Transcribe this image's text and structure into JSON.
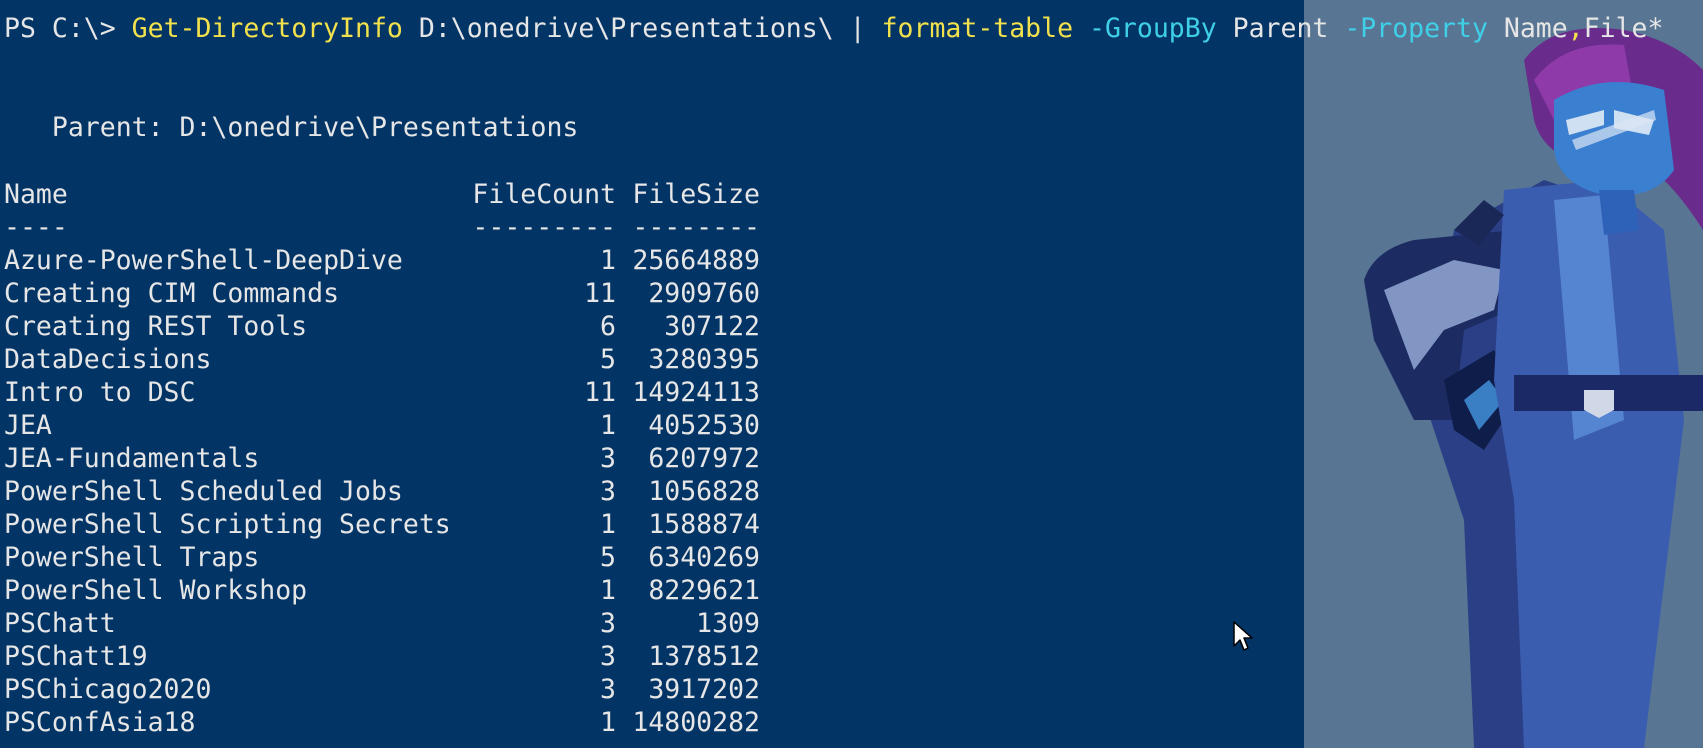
{
  "window": {
    "background": "#023466",
    "backdrop_color": "#587694"
  },
  "command": {
    "prompt": "PS C:\\>",
    "cmdlet": "Get-DirectoryInfo",
    "path": "D:\\onedrive\\Presentations\\",
    "pipe": "|",
    "formatter": "format-table",
    "param_groupby": "-GroupBy",
    "groupby_value": "Parent",
    "param_property": "-Property",
    "property_value_1": "Name",
    "comma": ",",
    "property_value_2": "File*",
    "colors": {
      "cmdlet": "#f2e14c",
      "parameter": "#3fd0e8",
      "text": "#e6e6e6"
    }
  },
  "group": {
    "label": "Parent:",
    "value": "D:\\onedrive\\Presentations"
  },
  "table": {
    "headers": [
      "Name",
      "FileCount",
      "FileSize"
    ],
    "dividers": [
      "----",
      "---------",
      "--------"
    ],
    "rows": [
      {
        "name": "Azure-PowerShell-DeepDive",
        "count": "1",
        "size": "25664889"
      },
      {
        "name": "Creating CIM Commands",
        "count": "11",
        "size": "2909760"
      },
      {
        "name": "Creating REST Tools",
        "count": "6",
        "size": "307122"
      },
      {
        "name": "DataDecisions",
        "count": "5",
        "size": "3280395"
      },
      {
        "name": "Intro to DSC",
        "count": "11",
        "size": "14924113"
      },
      {
        "name": "JEA",
        "count": "1",
        "size": "4052530"
      },
      {
        "name": "JEA-Fundamentals",
        "count": "3",
        "size": "6207972"
      },
      {
        "name": "PowerShell Scheduled Jobs",
        "count": "3",
        "size": "1056828"
      },
      {
        "name": "PowerShell Scripting Secrets",
        "count": "1",
        "size": "1588874"
      },
      {
        "name": "PowerShell Traps",
        "count": "5",
        "size": "6340269"
      },
      {
        "name": "PowerShell Workshop",
        "count": "1",
        "size": "8229621"
      },
      {
        "name": "PSChatt",
        "count": "3",
        "size": "1309"
      },
      {
        "name": "PSChatt19",
        "count": "3",
        "size": "1378512"
      },
      {
        "name": "PSChicago2020",
        "count": "3",
        "size": "3917202"
      },
      {
        "name": "PSConfAsia18",
        "count": "1",
        "size": "14800282"
      }
    ]
  },
  "icons": {
    "cursor": "mouse-pointer-icon",
    "mascot": "powershell-mascot-illustration"
  }
}
